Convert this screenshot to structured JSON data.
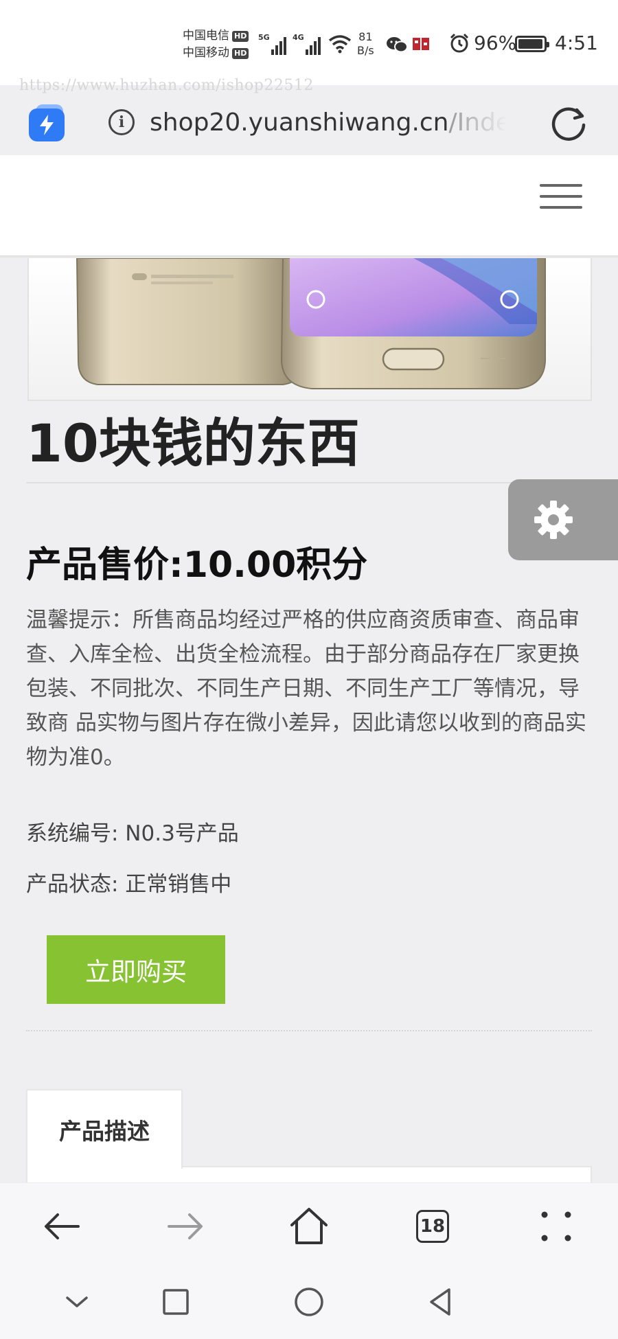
{
  "status_bar": {
    "carrier_1": "中国电信",
    "carrier_2": "中国移动",
    "hd_badge": "HD",
    "network_5g": "5G",
    "network_4g": "4G",
    "net_speed_value": "81",
    "net_speed_unit": "B/s",
    "battery_percent": "96%",
    "battery_level": 0.96,
    "time": "4:51"
  },
  "watermark": "https://www.huzhan.com/ishop22512",
  "browser": {
    "url_domain": "shop20.yuanshiwang.cn",
    "url_path": "/Inde",
    "info_symbol": "i",
    "open_tabs_count": "18"
  },
  "product": {
    "title": "10块钱的东西",
    "price": "产品售价:10.00积分",
    "notice": "温馨提示：所售商品均经过严格的供应商资质审查、商品审查、入库全检、出货全检流程。由于部分商品存在厂家更换包装、不同批次、不同生产日期、不同生产工厂等情况，导致商 品实物与图片存在微小差异，因此请您以收到的商品实物为准0。",
    "system_no": "系统编号: N0.3号产品",
    "status": "产品状态: 正常销售中",
    "buy_label": "立即购买",
    "desc_tab_label": "产品描述"
  },
  "colors": {
    "buy_button": "#86c232",
    "settings_tab": "#9b9b9b",
    "app_icon": "#2f7bf5",
    "page_background": "#efeff1"
  },
  "icons": {
    "browser_app": "lightning-bolt-icon",
    "refresh": "refresh-icon",
    "menu": "hamburger-menu-icon",
    "settings": "gear-icon",
    "back": "arrow-left-icon",
    "forward": "arrow-right-icon",
    "home": "home-icon",
    "more": "four-dots-icon",
    "nav_down": "chevron-down-icon",
    "nav_recent": "square-icon",
    "nav_home": "circle-icon",
    "nav_back": "triangle-back-icon"
  }
}
